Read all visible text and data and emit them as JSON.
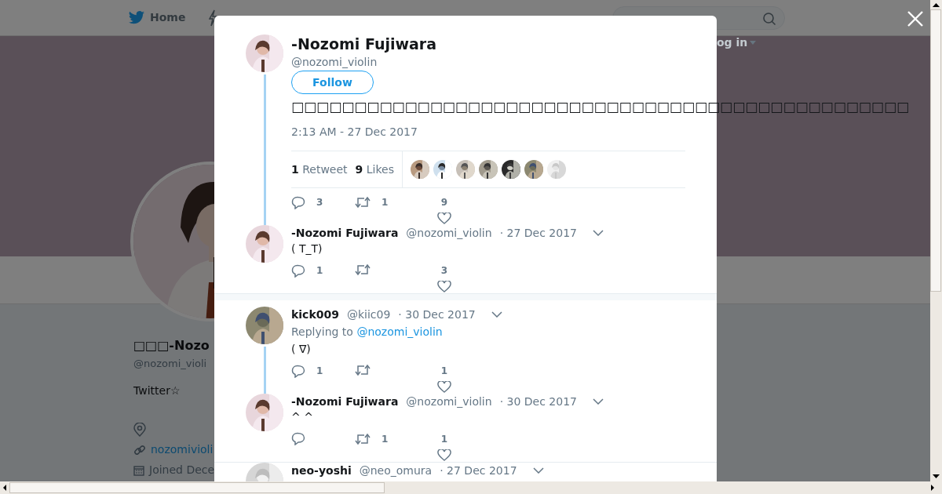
{
  "nav": {
    "home": "Home",
    "login": "og in"
  },
  "profile": {
    "name": "□□□-Nozo",
    "handle": "@nozomi_violi",
    "bio": "Twitter☆",
    "website": "nozomivioli",
    "joined": "Joined Dece"
  },
  "main_tweet": {
    "name": "-Nozomi Fujiwara",
    "handle": "@nozomi_violin",
    "follow": "Follow",
    "text": "□□□□□□□□□□□□□□□□□□□□□□□□□□□□□□□□□□□□□□□□□□□□□□□□□",
    "time": "2:13 AM - 27 Dec 2017",
    "retweet_count": "1",
    "retweet_label": "Retweet",
    "like_count": "9",
    "like_label": "Likes",
    "reply_count": "3",
    "retweets": "1",
    "likes": "9"
  },
  "thread": [
    {
      "name": "-Nozomi Fujiwara",
      "handle": "@nozomi_violin",
      "date": "· 27 Dec 2017",
      "text": "( T_T)",
      "reply_count": "1",
      "likes": "3"
    }
  ],
  "conversations": [
    [
      {
        "name": "kick009",
        "handle": "@kiic09",
        "date": "· 30 Dec 2017",
        "replying_label": "Replying to",
        "replying_handle": "@nozomi_violin",
        "text": "( ∇)",
        "reply_count": "1",
        "likes": "1"
      },
      {
        "name": "-Nozomi Fujiwara",
        "handle": "@nozomi_violin",
        "date": "· 30 Dec 2017",
        "text": "^ ^",
        "retweets": "1",
        "likes": "1"
      }
    ],
    [
      {
        "name": "neo-yoshi",
        "handle": "@neo_omura",
        "date": "· 27 Dec 2017"
      }
    ]
  ]
}
